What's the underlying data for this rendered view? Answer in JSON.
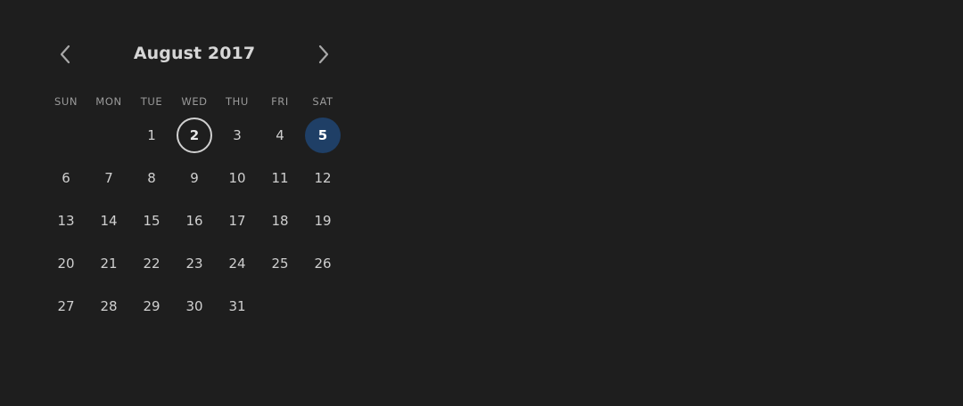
{
  "calendar": {
    "title": "August 2017",
    "prev_icon": "chevron-left-icon",
    "next_icon": "chevron-right-icon",
    "weekdays": [
      "SUN",
      "MON",
      "TUE",
      "WED",
      "THU",
      "FRI",
      "SAT"
    ],
    "leading_blank_days": 2,
    "days": [
      "1",
      "2",
      "3",
      "4",
      "5",
      "6",
      "7",
      "8",
      "9",
      "10",
      "11",
      "12",
      "13",
      "14",
      "15",
      "16",
      "17",
      "18",
      "19",
      "20",
      "21",
      "22",
      "23",
      "24",
      "25",
      "26",
      "27",
      "28",
      "29",
      "30",
      "31"
    ],
    "today": "2",
    "selected": "5",
    "colors": {
      "background": "#1e1e1e",
      "selected": "#1f3f66",
      "text": "#cfcfcf",
      "weekday_text": "#9a9a9a"
    }
  }
}
